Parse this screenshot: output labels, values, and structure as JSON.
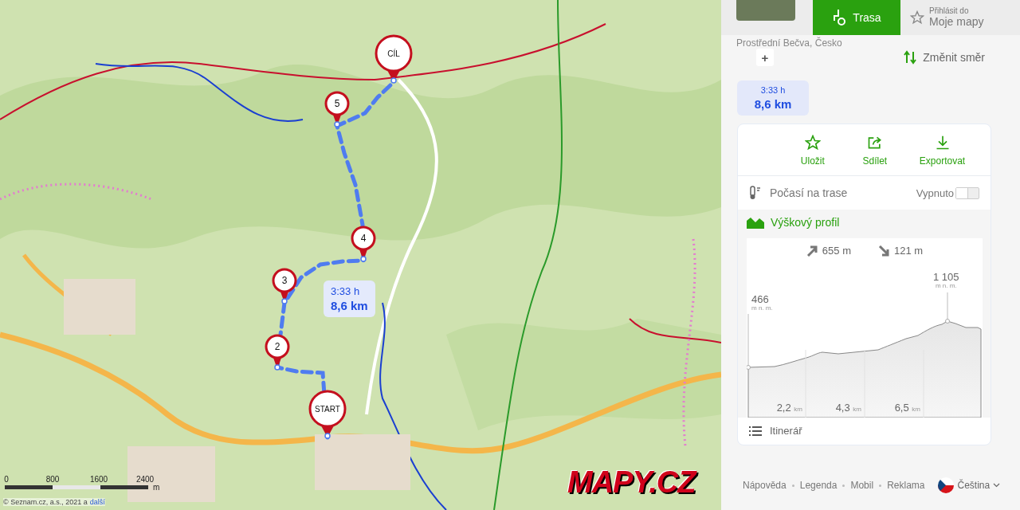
{
  "place_header": {
    "subtitle": "Prostřední Bečva, Česko"
  },
  "route_button": {
    "label": "Trasa"
  },
  "login": {
    "line1": "Přihlásit do",
    "line2": "Moje mapy"
  },
  "add_stop": {
    "label": "+"
  },
  "reverse": {
    "label": "Změnit směr"
  },
  "summary": {
    "time": "3:33 h",
    "distance": "8,6 km"
  },
  "actions": [
    {
      "kind": "save",
      "label": "Uložit"
    },
    {
      "kind": "share",
      "label": "Sdílet"
    },
    {
      "kind": "export",
      "label": "Exportovat"
    }
  ],
  "weather": {
    "label": "Počasí na trase",
    "state": "Vypnuto",
    "on": false
  },
  "profile": {
    "title": "Výškový profil",
    "ascent": "655 m",
    "descent": "121 m",
    "start_elevation": {
      "value": "466",
      "unit": "m n. m."
    },
    "max_elevation": {
      "value": "1 105",
      "unit": "m n. m."
    },
    "distance_ticks": [
      {
        "value": "2,2",
        "unit": "km"
      },
      {
        "value": "4,3",
        "unit": "km"
      },
      {
        "value": "6,5",
        "unit": "km"
      }
    ]
  },
  "itinerary": {
    "label": "Itinerář"
  },
  "footer": {
    "links": [
      "Nápověda",
      "Legenda",
      "Mobil",
      "Reklama"
    ],
    "language": "Čeština"
  },
  "map": {
    "markers": [
      {
        "kind": "start",
        "label": "START"
      },
      {
        "kind": "end",
        "label": "CÍL"
      },
      {
        "kind": "waypoint",
        "label": "2"
      },
      {
        "kind": "waypoint",
        "label": "3"
      },
      {
        "kind": "waypoint",
        "label": "4"
      },
      {
        "kind": "waypoint",
        "label": "5"
      }
    ],
    "route_label": {
      "time": "3:33 h",
      "distance": "8,6 km"
    },
    "scale": {
      "ticks": [
        "0",
        "800",
        "1600",
        "2400"
      ],
      "unit": "m"
    },
    "copyright": "© Seznam.cz, a.s., 2021 a",
    "copyright_link": "další",
    "logo": "MAPY.CZ"
  }
}
